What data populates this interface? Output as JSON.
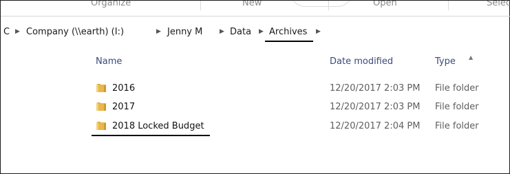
{
  "ribbon": {
    "groups": [
      "Organize",
      "New",
      "Open",
      "Selec"
    ]
  },
  "address": {
    "crumbs": [
      "C",
      "Company (\\\\earth) (I:)",
      "Jenny M",
      "Data",
      "Archives"
    ]
  },
  "columns": {
    "name": "Name",
    "date_modified": "Date modified",
    "type": "Type"
  },
  "files": [
    {
      "name": "2016",
      "date": "12/20/2017 2:03 PM",
      "type": "File folder"
    },
    {
      "name": "2017",
      "date": "12/20/2017 2:03 PM",
      "type": "File folder"
    },
    {
      "name": "2018 Locked Budget",
      "date": "12/20/2017 2:04 PM",
      "type": "File folder"
    }
  ],
  "colors": {
    "folder_yellow": "#e8b84a",
    "header_text": "#3b4a78"
  },
  "icons": {
    "folder": "folder-icon",
    "crumb_separator": "chevron-right-icon",
    "sort": "sort-up-icon"
  }
}
